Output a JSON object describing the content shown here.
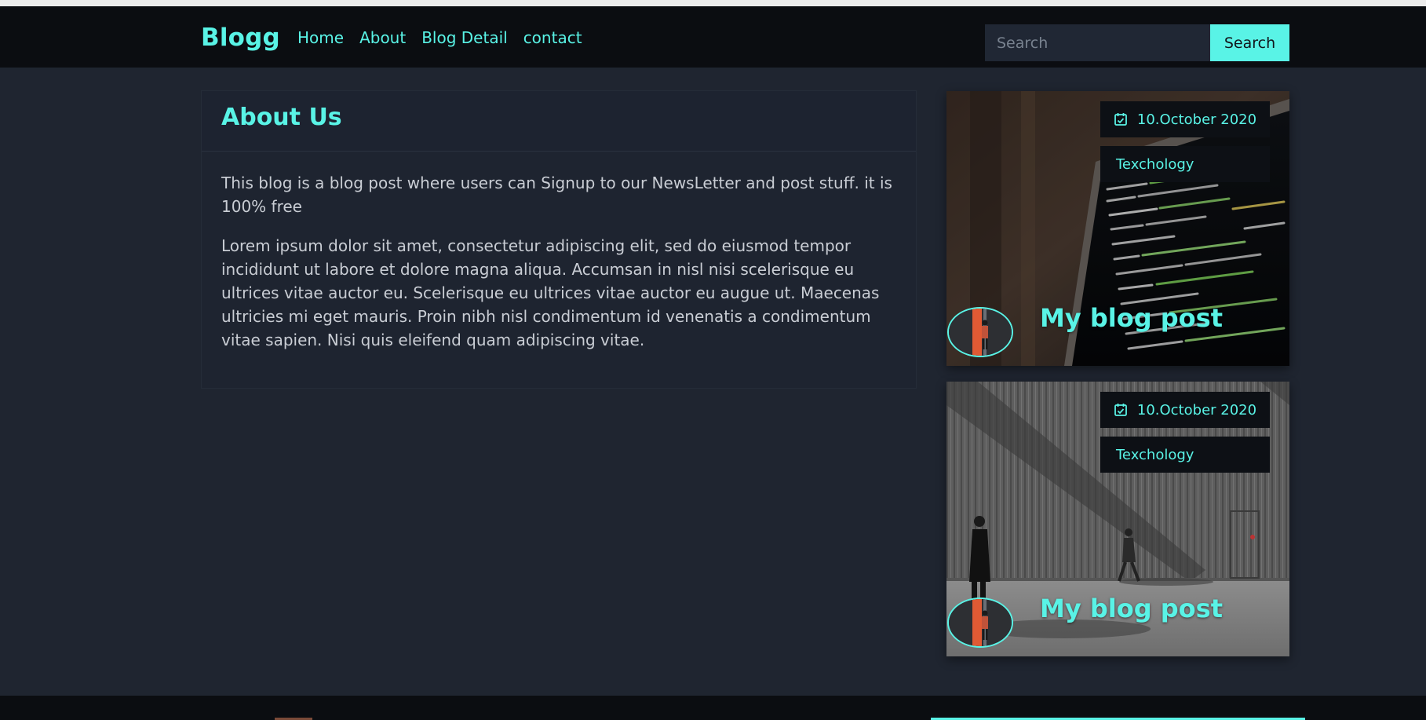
{
  "navbar": {
    "brand": "Blogg",
    "links": [
      "Home",
      "About",
      "Blog Detail",
      "contact"
    ],
    "search_placeholder": "Search",
    "search_button": "Search"
  },
  "about": {
    "title": "About Us",
    "paragraph1": "This blog is a blog post where users can Signup to our NewsLetter and post stuff. it is 100% free",
    "paragraph2": "Lorem ipsum dolor sit amet, consectetur adipiscing elit, sed do eiusmod tempor incididunt ut labore et dolore magna aliqua. Accumsan in nisl nisi scelerisque eu ultrices vitae auctor eu. Scelerisque eu ultrices vitae auctor eu augue ut. Maecenas ultricies mi eget mauris. Proin nibh nisl condimentum id venenatis a condimentum vitae sapien. Nisi quis eleifend quam adipiscing vitae."
  },
  "posts": [
    {
      "date": "10.October 2020",
      "category": "Texchology",
      "title": "My blog post",
      "image": "laptop-code-photo"
    },
    {
      "date": "10.October 2020",
      "category": "Texchology",
      "title": "My blog post",
      "image": "street-walkers-photo"
    }
  ],
  "colors": {
    "accent": "#59f3e6",
    "background": "#1f2530",
    "navbar": "#0b0d11"
  }
}
